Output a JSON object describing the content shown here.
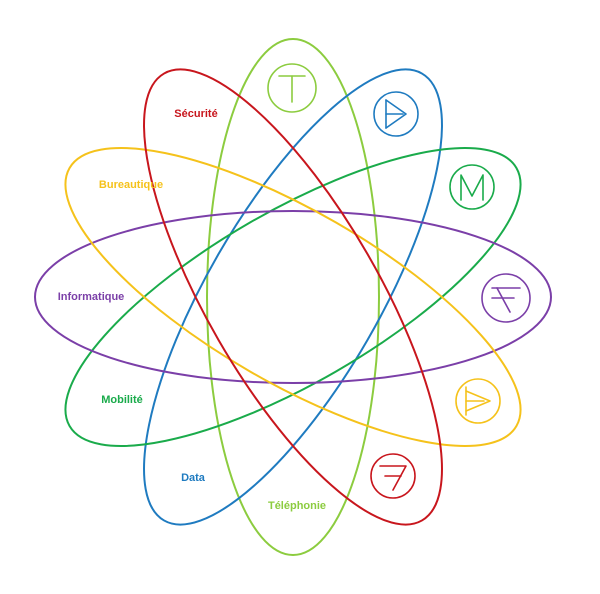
{
  "diagram": {
    "domains": [
      {
        "id": "telephonie",
        "label": "Téléphonie",
        "color": "#8ccc3f",
        "icon": "letter-t-icon"
      },
      {
        "id": "data",
        "label": "Data",
        "color": "#1f7bc0",
        "icon": "letter-d-icon"
      },
      {
        "id": "mobilite",
        "label": "Mobilité",
        "color": "#1aab4b",
        "icon": "letter-m-icon"
      },
      {
        "id": "informatique",
        "label": "Informatique",
        "color": "#7b3fa8",
        "icon": "letter-f-icon"
      },
      {
        "id": "bureautique",
        "label": "Bureautique",
        "color": "#f5c21b",
        "icon": "letter-b-icon"
      },
      {
        "id": "securite",
        "label": "Sécurité",
        "color": "#c8161d",
        "icon": "letter-s-icon"
      }
    ]
  }
}
